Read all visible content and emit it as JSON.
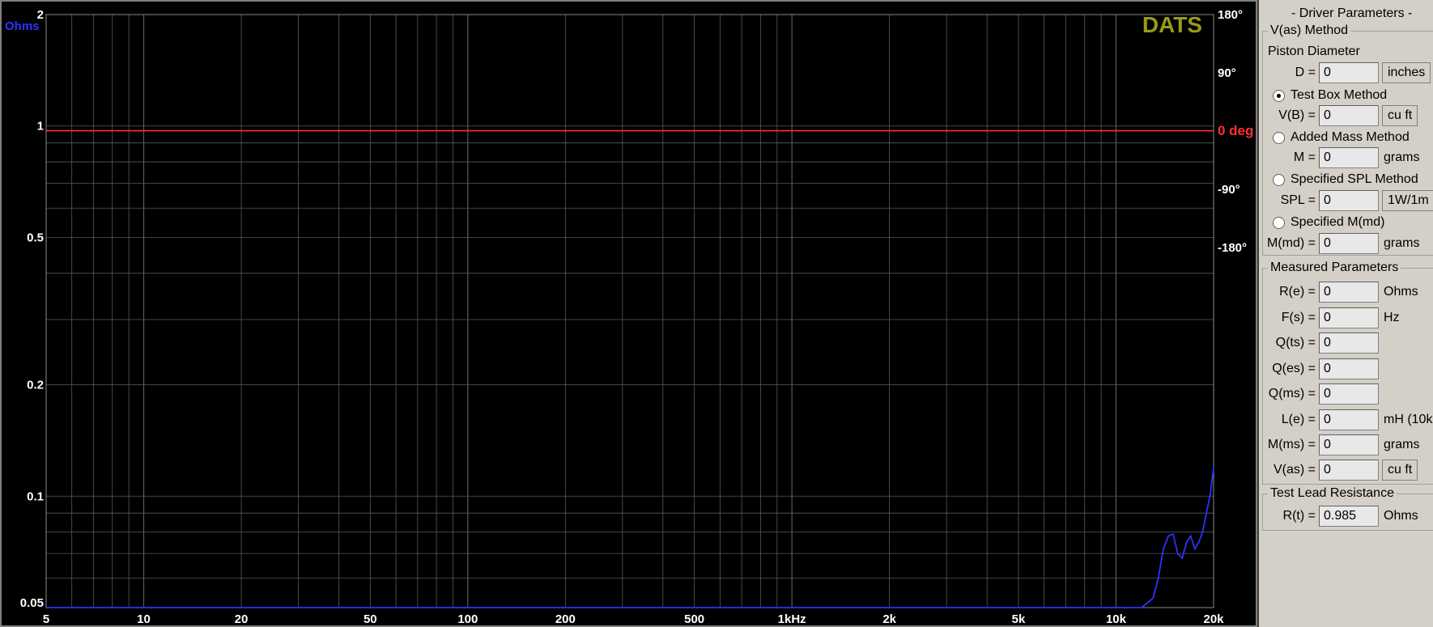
{
  "plot": {
    "watermark": "DATS",
    "y_unit_label": "Ohms",
    "phase_zero_label": "0 deg",
    "colors": {
      "impedance": "#3030ff",
      "phase": "#ff3030",
      "watermark": "#9a9a1a",
      "grid": "#5a5a5a",
      "axis_text": "#ffffff"
    }
  },
  "chart_data": {
    "type": "line",
    "x_scale": "log",
    "y_scale": "log",
    "xlim": [
      5,
      20000
    ],
    "ylim": [
      0.05,
      2
    ],
    "x_tick_labels": [
      "5",
      "10",
      "20",
      "50",
      "100",
      "200",
      "500",
      "1kHz",
      "2k",
      "5k",
      "10k",
      "20k"
    ],
    "x_tick_values": [
      5,
      10,
      20,
      50,
      100,
      200,
      500,
      1000,
      2000,
      5000,
      10000,
      20000
    ],
    "y_tick_labels": [
      "2",
      "1",
      "0.5",
      "0.2",
      "0.1",
      "0.05"
    ],
    "y_tick_values": [
      2,
      1,
      0.5,
      0.2,
      0.1,
      0.05
    ],
    "phase_axis": {
      "range": [
        -180,
        180
      ],
      "tick_labels": [
        "180°",
        "90°",
        "0 deg",
        "-90°",
        "-180°"
      ],
      "tick_values": [
        180,
        90,
        0,
        -90,
        -180
      ]
    },
    "grid": true,
    "series": [
      {
        "axis": "impedance",
        "points": [
          [
            5,
            0.05
          ],
          [
            12000,
            0.05
          ],
          [
            13000,
            0.053
          ],
          [
            13500,
            0.06
          ],
          [
            14000,
            0.072
          ],
          [
            14500,
            0.078
          ],
          [
            15000,
            0.079
          ],
          [
            15500,
            0.07
          ],
          [
            16000,
            0.068
          ],
          [
            16500,
            0.075
          ],
          [
            17000,
            0.078
          ],
          [
            17500,
            0.072
          ],
          [
            18000,
            0.075
          ],
          [
            18500,
            0.08
          ],
          [
            19000,
            0.09
          ],
          [
            19500,
            0.1
          ],
          [
            20000,
            0.12
          ]
        ]
      },
      {
        "axis": "phase",
        "points": [
          [
            5,
            0.5
          ],
          [
            20000,
            0.5
          ]
        ]
      }
    ]
  },
  "panel": {
    "title": "- Driver Parameters -",
    "vas_group": {
      "legend": "V(as) Method",
      "piston_label": "Piston Diameter",
      "d_label": "D =",
      "d_value": "0",
      "d_unit": "inches",
      "test_box_label": "Test Box Method",
      "vb_label": "V(B) =",
      "vb_value": "0",
      "vb_unit": "cu ft",
      "added_mass_label": "Added Mass Method",
      "m_label": "M =",
      "m_value": "0",
      "m_unit": "grams",
      "spl_method_label": "Specified SPL Method",
      "spl_label": "SPL =",
      "spl_value": "0",
      "spl_unit": "1W/1m",
      "mmd_method_label": "Specified M(md)",
      "mmd_label": "M(md) =",
      "mmd_value": "0",
      "mmd_unit": "grams"
    },
    "measured_group": {
      "legend": "Measured Parameters",
      "rows": [
        {
          "label": "R(e) =",
          "value": "0",
          "unit": "Ohms"
        },
        {
          "label": "F(s) =",
          "value": "0",
          "unit": "Hz"
        },
        {
          "label": "Q(ts) =",
          "value": "0",
          "unit": ""
        },
        {
          "label": "Q(es) =",
          "value": "0",
          "unit": ""
        },
        {
          "label": "Q(ms) =",
          "value": "0",
          "unit": ""
        },
        {
          "label": "L(e) =",
          "value": "0",
          "unit": "mH (10k"
        },
        {
          "label": "M(ms) =",
          "value": "0",
          "unit": "grams"
        },
        {
          "label": "V(as) =",
          "value": "0",
          "unit": "cu ft"
        }
      ]
    },
    "lead_group": {
      "legend": "Test Lead Resistance",
      "rt_label": "R(t) =",
      "rt_value": "0.985",
      "rt_unit": "Ohms"
    }
  }
}
